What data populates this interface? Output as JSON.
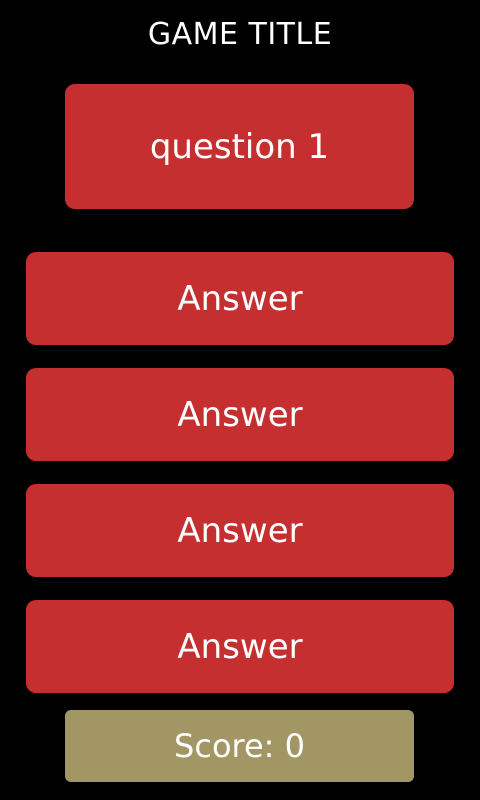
{
  "game": {
    "title": "GAME TITLE"
  },
  "question": {
    "text": "question 1"
  },
  "answers": [
    {
      "label": "Answer"
    },
    {
      "label": "Answer"
    },
    {
      "label": "Answer"
    },
    {
      "label": "Answer"
    }
  ],
  "score": {
    "text": "Score: 0"
  },
  "colors": {
    "background": "#000000",
    "text": "#ffffff",
    "card_red": "#c62f2f",
    "score_gold": "#a39665"
  }
}
